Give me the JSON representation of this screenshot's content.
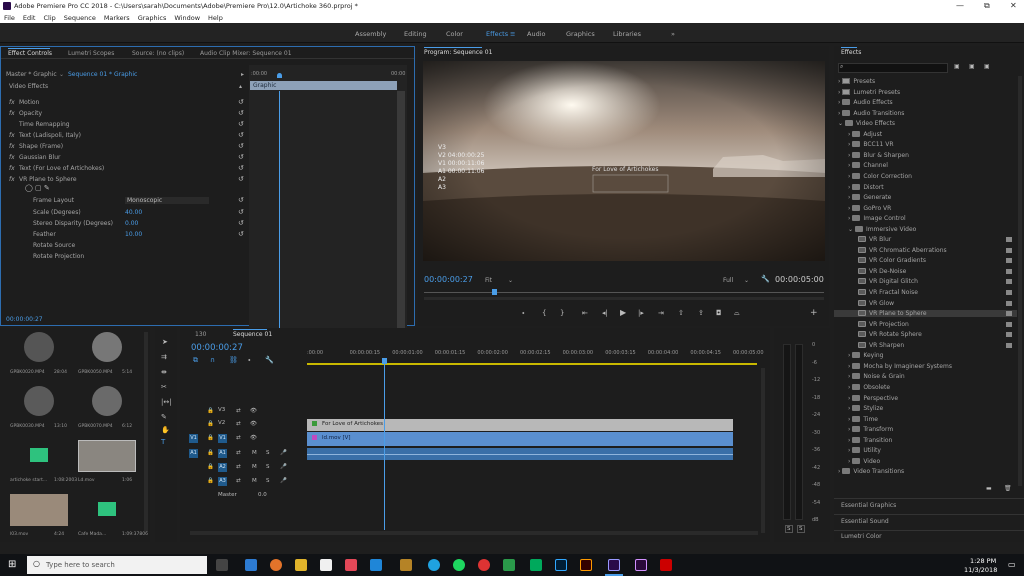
{
  "titlebar": {
    "title": "Adobe Premiere Pro CC 2018 - C:\\Users\\sarah\\Documents\\Adobe\\Premiere Pro\\12.0\\Artichoke 360.prproj *",
    "minimize": "—",
    "maximize": "⧉",
    "close": "✕"
  },
  "menu": [
    "File",
    "Edit",
    "Clip",
    "Sequence",
    "Markers",
    "Graphics",
    "Window",
    "Help"
  ],
  "workspaces": [
    "Assembly",
    "Editing",
    "Color",
    "Effects",
    "Audio",
    "Graphics",
    "Libraries"
  ],
  "workspace_more": "»",
  "effect_controls": {
    "tabs": [
      "Effect Controls",
      "Lumetri Scopes",
      "Source: (no clips)",
      "Audio Clip Mixer: Sequence 01"
    ],
    "master": "Master * Graphic",
    "clip": "Sequence 01 * Graphic",
    "time_start": ":00:00",
    "time_end": "00:00",
    "clip_bar": "Graphic",
    "section": "Video Effects",
    "rows": [
      {
        "label": "Motion",
        "fx": "fx"
      },
      {
        "label": "Opacity",
        "fx": "fx"
      },
      {
        "label": "Time Remapping",
        "fx": ""
      },
      {
        "label": "Text (Ladispoli, Italy)",
        "fx": "fx"
      },
      {
        "label": "Shape (Frame)",
        "fx": "fx"
      },
      {
        "label": "Gaussian Blur",
        "fx": "fx"
      },
      {
        "label": "Text (For Love of Artichokes)",
        "fx": "fx"
      },
      {
        "label": "VR Plane to Sphere",
        "fx": "fx"
      }
    ],
    "params": [
      {
        "label": "Frame Layout",
        "value": "Monoscopic"
      },
      {
        "label": "Scale (Degrees)",
        "value": "40.00"
      },
      {
        "label": "Stereo Disparity (Degrees)",
        "value": "0.00"
      },
      {
        "label": "Feather",
        "value": "10.00"
      },
      {
        "label": "Rotate Source",
        "value": ""
      },
      {
        "label": "Rotate Projection",
        "value": ""
      }
    ],
    "timecode": "00:00:00:27"
  },
  "program": {
    "title": "Program: Sequence 01",
    "timecode": "00:00:00:27",
    "fit": "Fit",
    "quality": "Full",
    "duration": "00:00:05:00",
    "overlay": [
      "V3",
      "V2 04:00:00:25",
      "V1 00:00:11:06",
      "A1 00:00:11:06",
      "A2",
      "A3"
    ],
    "title_box": "For Love of Artichokes"
  },
  "project": {
    "items": [
      {
        "name": "GPBK0020.MP4",
        "dur": "28:04"
      },
      {
        "name": "GPBK0050.MP4",
        "dur": "5:14"
      },
      {
        "name": "GPBK0030.MP4",
        "dur": "13:10"
      },
      {
        "name": "GPBK0070.MP4",
        "dur": "6:12"
      },
      {
        "name": "artichoke start...",
        "dur": "1:08:2003"
      },
      {
        "name": "Ld.mov",
        "dur": "1:06"
      },
      {
        "name": "l03.mov",
        "dur": "4:24"
      },
      {
        "name": "Cafe Mada...",
        "dur": "1:09:37806"
      }
    ]
  },
  "timeline": {
    "tab_prev": "130",
    "tab": "Sequence 01",
    "timecode": "00:00:00:27",
    "ruler": [
      ":00:00",
      "00:00:00:15",
      "00:00:01:00",
      "00:00:01:15",
      "00:00:02:00",
      "00:00:02:15",
      "00:00:03:00",
      "00:00:03:15",
      "00:00:04:00",
      "00:00:04:15",
      "00:00:05:00"
    ],
    "tracks": [
      "V3",
      "V2",
      "V1",
      "A1",
      "A2",
      "A3"
    ],
    "master": "Master",
    "master_val": "0.0",
    "clips": {
      "v2": "For Love of Artichokes",
      "v1": "ld.mov [V]"
    },
    "meter": [
      "0",
      "-6",
      "-12",
      "-18",
      "-24",
      "-30",
      "-36",
      "-42",
      "-48",
      "-54",
      "dB"
    ],
    "solo": "S"
  },
  "effects": {
    "title": "Effects",
    "tree": [
      {
        "t": "Presets",
        "lvl": 0,
        "kind": "pres"
      },
      {
        "t": "Lumetri Presets",
        "lvl": 0,
        "kind": "pres"
      },
      {
        "t": "Audio Effects",
        "lvl": 0,
        "kind": "fold"
      },
      {
        "t": "Audio Transitions",
        "lvl": 0,
        "kind": "fold"
      },
      {
        "t": "Video Effects",
        "lvl": 0,
        "kind": "fold",
        "open": true
      },
      {
        "t": "Adjust",
        "lvl": 1,
        "kind": "fold"
      },
      {
        "t": "BCC11 VR",
        "lvl": 1,
        "kind": "fold"
      },
      {
        "t": "Blur & Sharpen",
        "lvl": 1,
        "kind": "fold"
      },
      {
        "t": "Channel",
        "lvl": 1,
        "kind": "fold"
      },
      {
        "t": "Color Correction",
        "lvl": 1,
        "kind": "fold"
      },
      {
        "t": "Distort",
        "lvl": 1,
        "kind": "fold"
      },
      {
        "t": "Generate",
        "lvl": 1,
        "kind": "fold"
      },
      {
        "t": "GoPro VR",
        "lvl": 1,
        "kind": "fold"
      },
      {
        "t": "Image Control",
        "lvl": 1,
        "kind": "fold"
      },
      {
        "t": "Immersive Video",
        "lvl": 1,
        "kind": "fold",
        "open": true
      },
      {
        "t": "VR Blur",
        "lvl": 2,
        "kind": "fx"
      },
      {
        "t": "VR Chromatic Aberrations",
        "lvl": 2,
        "kind": "fx"
      },
      {
        "t": "VR Color Gradients",
        "lvl": 2,
        "kind": "fx"
      },
      {
        "t": "VR De-Noise",
        "lvl": 2,
        "kind": "fx"
      },
      {
        "t": "VR Digital Glitch",
        "lvl": 2,
        "kind": "fx"
      },
      {
        "t": "VR Fractal Noise",
        "lvl": 2,
        "kind": "fx"
      },
      {
        "t": "VR Glow",
        "lvl": 2,
        "kind": "fx"
      },
      {
        "t": "VR Plane to Sphere",
        "lvl": 2,
        "kind": "fx",
        "selected": true
      },
      {
        "t": "VR Projection",
        "lvl": 2,
        "kind": "fx"
      },
      {
        "t": "VR Rotate Sphere",
        "lvl": 2,
        "kind": "fx"
      },
      {
        "t": "VR Sharpen",
        "lvl": 2,
        "kind": "fx"
      },
      {
        "t": "Keying",
        "lvl": 1,
        "kind": "fold"
      },
      {
        "t": "Mocha by Imagineer Systems",
        "lvl": 1,
        "kind": "fold"
      },
      {
        "t": "Noise & Grain",
        "lvl": 1,
        "kind": "fold"
      },
      {
        "t": "Obsolete",
        "lvl": 1,
        "kind": "fold"
      },
      {
        "t": "Perspective",
        "lvl": 1,
        "kind": "fold"
      },
      {
        "t": "Stylize",
        "lvl": 1,
        "kind": "fold"
      },
      {
        "t": "Time",
        "lvl": 1,
        "kind": "fold"
      },
      {
        "t": "Transform",
        "lvl": 1,
        "kind": "fold"
      },
      {
        "t": "Transition",
        "lvl": 1,
        "kind": "fold"
      },
      {
        "t": "Utility",
        "lvl": 1,
        "kind": "fold"
      },
      {
        "t": "Video",
        "lvl": 1,
        "kind": "fold"
      },
      {
        "t": "Video Transitions",
        "lvl": 0,
        "kind": "fold"
      }
    ],
    "panels": [
      "Essential Graphics",
      "Essential Sound",
      "Lumetri Color"
    ]
  },
  "taskbar": {
    "search": "Type here to search",
    "time": "1:28 PM",
    "date": "11/3/2018"
  },
  "colors": {
    "accent": "#4a9de8",
    "clip_v2": "#b8b8b8",
    "clip_v1": "#5a8fcf",
    "clip_a1": "#3a6fa8"
  }
}
